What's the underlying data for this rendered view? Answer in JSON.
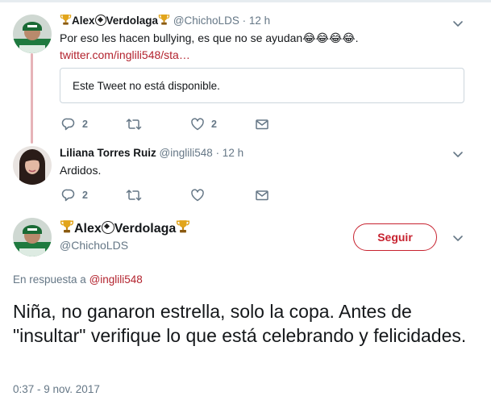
{
  "tweet1": {
    "name": "Alex",
    "name_suffix": "Verdolaga",
    "handle": "@ChichoLDS",
    "time": "· 12 h",
    "text": "Por eso les hacen bullying, es que no se ayudan",
    "emojis": [
      "😂",
      "😂",
      "😂",
      "😂"
    ],
    "text_end": ".",
    "link": "twitter.com/inglili548/sta…",
    "quote_unavailable": "Este Tweet no está disponible.",
    "reply_count": "2",
    "like_count": "2"
  },
  "tweet2": {
    "name": "Liliana Torres Ruiz",
    "handle": "@inglili548",
    "time": "· 12 h",
    "text": "Ardidos.",
    "reply_count": "2"
  },
  "main_tweet": {
    "name": "Alex",
    "name_suffix": "Verdolaga",
    "handle": "@ChichoLDS",
    "follow_label": "Seguir",
    "reply_prefix": "En respuesta a",
    "reply_handle": "@inglili548",
    "text": "Niña, no ganaron estrella, solo la copa. Antes de \"insultar\" verifique lo que está celebrando y felicidades.",
    "timestamp": "0:37 - 9 nov. 2017"
  },
  "colors": {
    "accent": "#b3232e",
    "follow": "#c7222f",
    "thread_line": "#e6b3b8",
    "muted": "#657786"
  },
  "icons": [
    "reply-icon",
    "retweet-icon",
    "like-icon",
    "dm-icon",
    "chevron-down-icon",
    "trophy-icon",
    "soccer-ball-icon"
  ]
}
